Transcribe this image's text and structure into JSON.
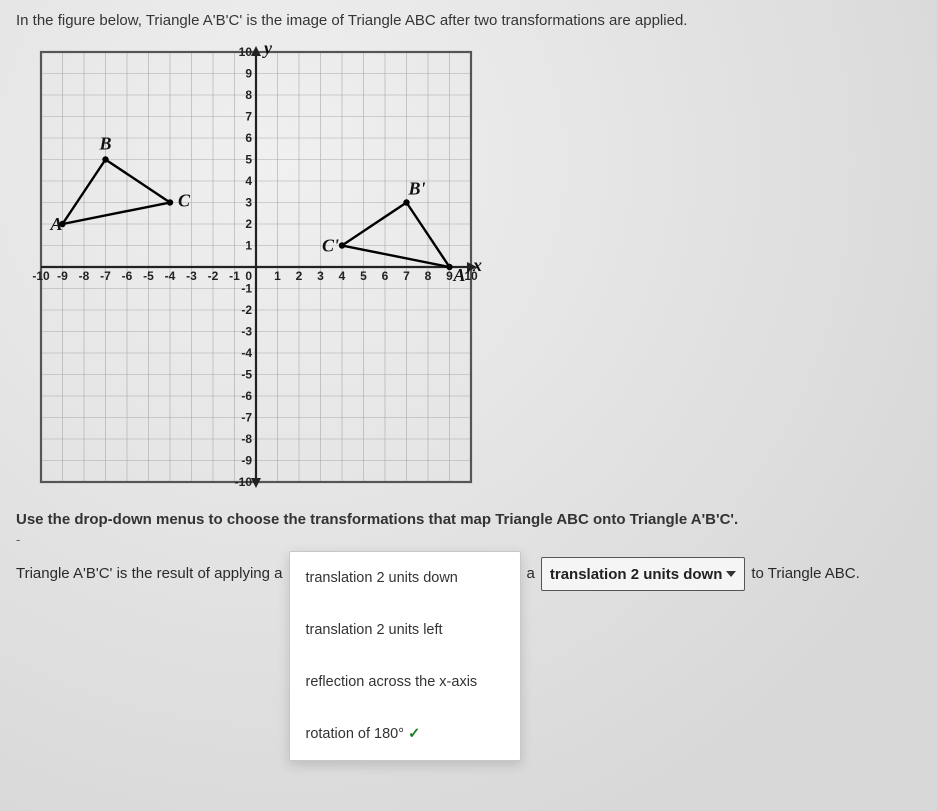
{
  "prompt": "In the figure below, Triangle A'B'C' is the image of Triangle ABC after two transformations are applied.",
  "instruction": "Use the drop-down menus to choose the transformations that map Triangle ABC onto Triangle A'B'C'.",
  "chart_data": {
    "type": "scatter",
    "xlim": [
      -10,
      10
    ],
    "ylim": [
      -10,
      10
    ],
    "xlabel": "x",
    "ylabel": "y",
    "x_ticks": [
      -10,
      -9,
      -8,
      -7,
      -6,
      -5,
      -4,
      -3,
      -2,
      -1,
      0,
      1,
      2,
      3,
      4,
      5,
      6,
      7,
      8,
      9,
      10
    ],
    "y_ticks": [
      -10,
      -9,
      -8,
      -7,
      -6,
      -5,
      -4,
      -3,
      -2,
      -1,
      1,
      2,
      3,
      4,
      5,
      6,
      7,
      8,
      9,
      10
    ],
    "series": [
      {
        "name": "Triangle ABC",
        "points": [
          {
            "label": "A",
            "x": -9,
            "y": 2
          },
          {
            "label": "B",
            "x": -7,
            "y": 5
          },
          {
            "label": "C",
            "x": -4,
            "y": 3
          }
        ]
      },
      {
        "name": "Triangle A'B'C'",
        "points": [
          {
            "label": "A'",
            "x": 9,
            "y": 0
          },
          {
            "label": "B'",
            "x": 7,
            "y": 3
          },
          {
            "label": "C'",
            "x": 4,
            "y": 1
          }
        ]
      }
    ]
  },
  "answer": {
    "lead": "Triangle A'B'C' is the result of applying a",
    "between": "a",
    "trail": "to Triangle ABC.",
    "dropdown1": {
      "options": [
        "translation 2 units down",
        "translation 2 units left",
        "reflection across the x-axis",
        "rotation of 180°"
      ],
      "selected_index": 3,
      "check_mark": "✓"
    },
    "dropdown2": {
      "selected": "translation 2 units down"
    }
  }
}
